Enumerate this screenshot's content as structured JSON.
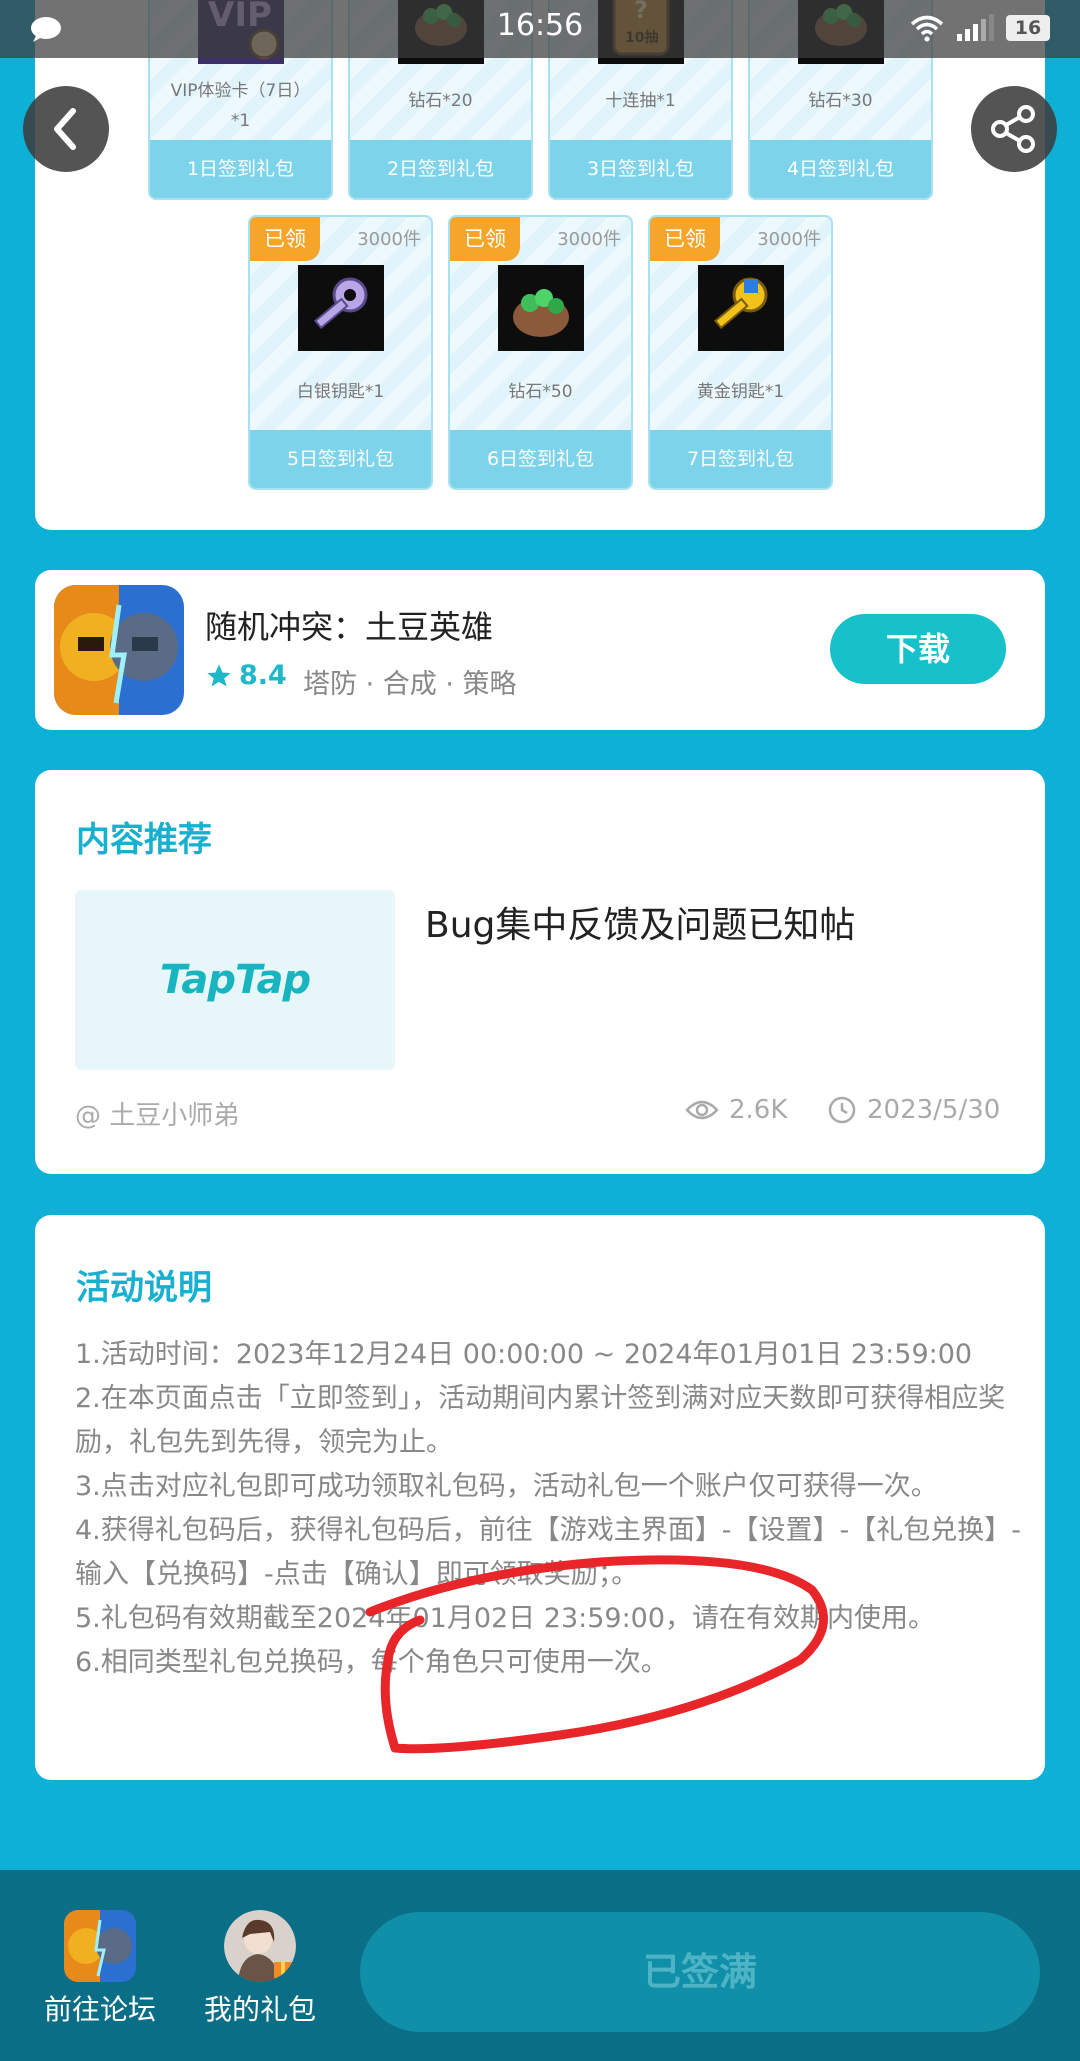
{
  "status_bar": {
    "time": "16:56",
    "battery": "16"
  },
  "gift_rows": {
    "row1": [
      {
        "name": "VIP体验卡（7日）*1",
        "button": "1日签到礼包",
        "thumb": "vip-card-icon"
      },
      {
        "name": "钻石*20",
        "button": "2日签到礼包",
        "thumb": "diamond-bag-icon"
      },
      {
        "name": "十连抽*1",
        "button": "3日签到礼包",
        "thumb": "ten-draw-ticket-icon"
      },
      {
        "name": "钻石*30",
        "button": "4日签到礼包",
        "thumb": "diamond-bag-icon"
      }
    ],
    "row2": [
      {
        "badge": "已领",
        "count": "3000件",
        "name": "白银钥匙*1",
        "button": "5日签到礼包",
        "thumb": "silver-key-icon"
      },
      {
        "badge": "已领",
        "count": "3000件",
        "name": "钻石*50",
        "button": "6日签到礼包",
        "thumb": "diamond-bag-icon"
      },
      {
        "badge": "已领",
        "count": "3000件",
        "name": "黄金钥匙*1",
        "button": "7日签到礼包",
        "thumb": "gold-key-icon"
      }
    ]
  },
  "game": {
    "title": "随机冲突：土豆英雄",
    "rating": "8.4",
    "tags": "塔防 · 合成 · 策略",
    "download": "下载"
  },
  "recommend": {
    "heading": "内容推荐",
    "thumb_logo": "TapTap",
    "post_title": "Bug集中反馈及问题已知帖",
    "author": "@ 土豆小师弟",
    "views": "2.6K",
    "date": "2023/5/30"
  },
  "rules": {
    "heading": "活动说明",
    "lines": [
      "1.活动时间：2023年12月24日 00:00:00 ~ 2024年01月01日 23:59:00",
      "2.在本页面点击「立即签到」，活动期间内累计签到满对应天数即可获得相应奖励，礼包先到先得，领完为止。",
      "3.点击对应礼包即可成功领取礼包码，活动礼包一个账户仅可获得一次。",
      "4.获得礼包码后，获得礼包码后，前往【游戏主界面】-【设置】-【礼包兑换】-输入【兑换码】-点击【确认】即可领取奖励；。",
      "5.礼包码有效期截至2024年01月02日 23:59:00，请在有效期内使用。",
      "6.相同类型礼包兑换码，每个角色只可使用一次。"
    ]
  },
  "bottom_bar": {
    "forum": "前往论坛",
    "gifts": "我的礼包",
    "signed": "已签满"
  },
  "colors": {
    "background": "#0fb0d6",
    "accent": "#18b0d0",
    "download": "#17c1c9",
    "claimed_badge": "#f5a62a",
    "annotation": "#e8262a"
  }
}
